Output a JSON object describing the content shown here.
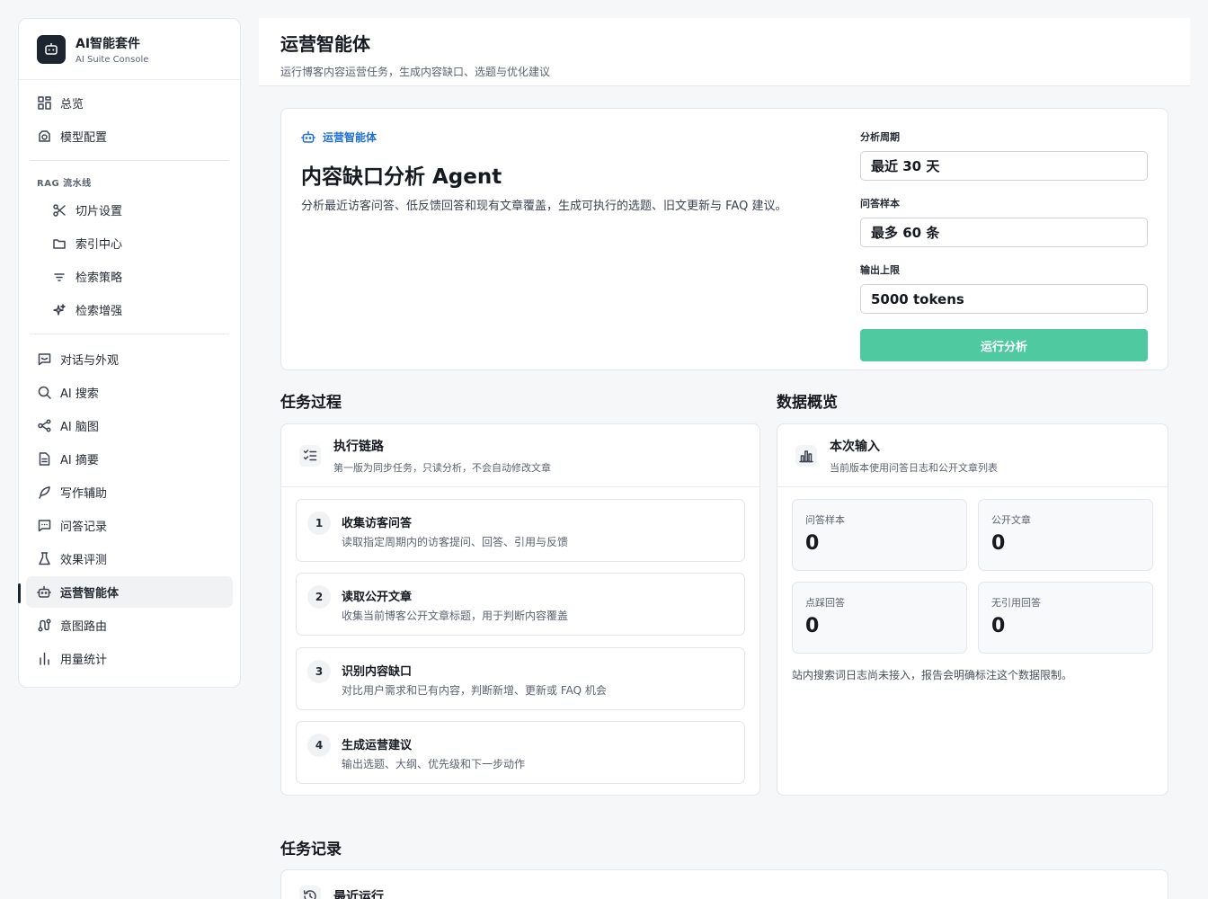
{
  "brand": {
    "name": "AI智能套件",
    "subtitle": "AI Suite Console"
  },
  "nav": {
    "overview": "总览",
    "model_config": "模型配置",
    "rag_group": "RAG 流水线",
    "chunking": "切片设置",
    "index_center": "索引中心",
    "retrieval_strategy": "检索策略",
    "retrieval_enhance": "检索增强",
    "chat_appearance": "对话与外观",
    "ai_search": "AI 搜索",
    "ai_mindmap": "AI 脑图",
    "ai_summary": "AI 摘要",
    "writing_assist": "写作辅助",
    "qa_records": "问答记录",
    "evaluation": "效果评测",
    "ops_agent": "运营智能体",
    "intent_routing": "意图路由",
    "usage_stats": "用量统计"
  },
  "header": {
    "title": "运营智能体",
    "subtitle": "运行博客内容运营任务，生成内容缺口、选题与优化建议"
  },
  "hero": {
    "tag": "运营智能体",
    "title": "内容缺口分析 Agent",
    "description": "分析最近访客问答、低反馈回答和现有文章覆盖，生成可执行的选题、旧文更新与 FAQ 建议。"
  },
  "form": {
    "period_label": "分析周期",
    "period_value": "最近 30 天",
    "samples_label": "问答样本",
    "samples_value": "最多 60 条",
    "output_label": "输出上限",
    "output_value": "5000 tokens",
    "run_button": "运行分析"
  },
  "process": {
    "section_title": "任务过程",
    "panel_title": "执行链路",
    "panel_subtitle": "第一版为同步任务，只读分析，不会自动修改文章",
    "steps": [
      {
        "num": "1",
        "title": "收集访客问答",
        "desc": "读取指定周期内的访客提问、回答、引用与反馈"
      },
      {
        "num": "2",
        "title": "读取公开文章",
        "desc": "收集当前博客公开文章标题，用于判断内容覆盖"
      },
      {
        "num": "3",
        "title": "识别内容缺口",
        "desc": "对比用户需求和已有内容，判断新增、更新或 FAQ 机会"
      },
      {
        "num": "4",
        "title": "生成运营建议",
        "desc": "输出选题、大纲、优先级和下一步动作"
      }
    ]
  },
  "overview": {
    "section_title": "数据概览",
    "panel_title": "本次输入",
    "panel_subtitle": "当前版本使用问答日志和公开文章列表",
    "stats": [
      {
        "label": "问答样本",
        "value": "0"
      },
      {
        "label": "公开文章",
        "value": "0"
      },
      {
        "label": "点踩回答",
        "value": "0"
      },
      {
        "label": "无引用回答",
        "value": "0"
      }
    ],
    "note": "站内搜索词日志尚未接入，报告会明确标注这个数据限制。"
  },
  "records": {
    "section_title": "任务记录",
    "panel_title": "最近运行"
  }
}
